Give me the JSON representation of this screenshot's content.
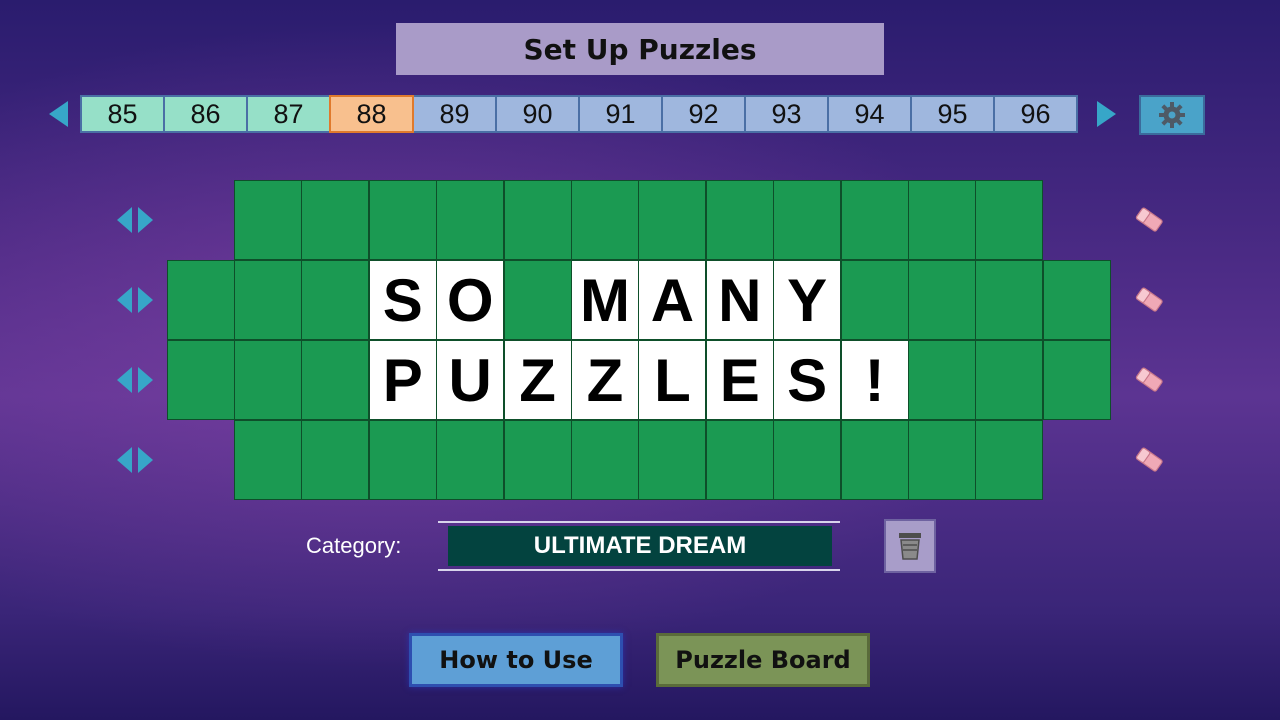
{
  "header": {
    "title": "Set Up Puzzles"
  },
  "puzzle_nav": {
    "numbers": [
      {
        "label": "85",
        "state": "done"
      },
      {
        "label": "86",
        "state": "done"
      },
      {
        "label": "87",
        "state": "done"
      },
      {
        "label": "88",
        "state": "active"
      },
      {
        "label": "89",
        "state": "normal"
      },
      {
        "label": "90",
        "state": "normal"
      },
      {
        "label": "91",
        "state": "normal"
      },
      {
        "label": "92",
        "state": "normal"
      },
      {
        "label": "93",
        "state": "normal"
      },
      {
        "label": "94",
        "state": "normal"
      },
      {
        "label": "95",
        "state": "normal"
      },
      {
        "label": "96",
        "state": "normal"
      }
    ],
    "prev_icon": "triangle-left-icon",
    "next_icon": "triangle-right-icon",
    "settings_icon": "gear-icon"
  },
  "board": {
    "rows": [
      {
        "cols": 12,
        "tiles": [
          "",
          "",
          "",
          "",
          "",
          "",
          "",
          "",
          "",
          "",
          "",
          ""
        ]
      },
      {
        "cols": 14,
        "tiles": [
          "",
          "",
          "",
          "S",
          "O",
          "",
          "M",
          "A",
          "N",
          "Y",
          "",
          "",
          "",
          ""
        ]
      },
      {
        "cols": 14,
        "tiles": [
          "",
          "",
          "",
          "P",
          "U",
          "Z",
          "Z",
          "L",
          "E",
          "S",
          "!",
          "",
          "",
          ""
        ]
      },
      {
        "cols": 12,
        "tiles": [
          "",
          "",
          "",
          "",
          "",
          "",
          "",
          "",
          "",
          "",
          "",
          ""
        ]
      }
    ],
    "row_control_icon": "left-right-arrows-icon",
    "row_clear_icon": "eraser-icon"
  },
  "category": {
    "label": "Category:",
    "value": "ULTIMATE DREAM",
    "clear_icon": "trash-icon"
  },
  "footer": {
    "how_to_use": "How to Use",
    "puzzle_board": "Puzzle Board"
  },
  "colors": {
    "tile_green": "#1b9a52",
    "tile_lit": "#ffffff",
    "number_done": "#96e0c8",
    "number_active": "#f8c08e",
    "number_normal": "#9fb7de",
    "category_bg": "#03433f",
    "arrow": "#37a6c8",
    "eraser": "#f0a9b6"
  }
}
